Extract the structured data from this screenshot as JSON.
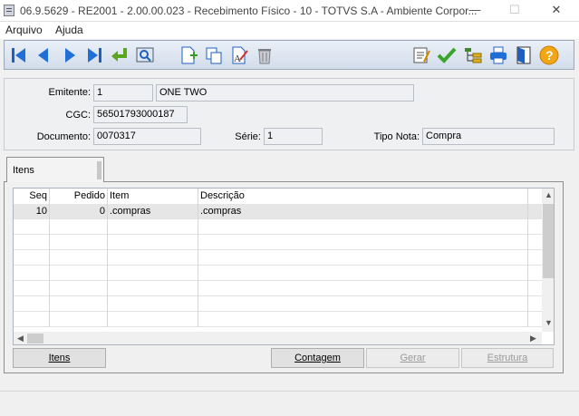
{
  "window": {
    "title": "06.9.5629 - RE2001 - 2.00.00.023 - Recebimento Físico - 10 - TOTVS S.A - Ambiente Corpor...",
    "minimize": "—",
    "maximize": "☐",
    "close": "✕"
  },
  "menu": {
    "items": [
      "Arquivo",
      "Ajuda"
    ]
  },
  "toolbar": {
    "nav_icons": [
      "first-record-icon",
      "previous-record-icon",
      "next-record-icon",
      "last-record-icon",
      "go-to-icon",
      "search-icon"
    ],
    "edit_icons": [
      "new-record-icon",
      "copy-record-icon",
      "edit-record-icon",
      "delete-record-icon"
    ],
    "right_icons": [
      "report-icon",
      "confirm-check-icon",
      "hierarchy-icon",
      "print-icon",
      "exit-door-icon",
      "help-icon"
    ]
  },
  "form": {
    "emitente_label": "Emitente:",
    "emitente_code": "1",
    "emitente_name": "ONE TWO",
    "cgc_label": "CGC:",
    "cgc_value": "56501793000187",
    "documento_label": "Documento:",
    "documento_value": "0070317",
    "serie_label": "Série:",
    "serie_value": "1",
    "tipo_nota_label": "Tipo Nota:",
    "tipo_nota_value": "Compra"
  },
  "tab": {
    "label": "Itens"
  },
  "grid": {
    "columns": [
      "Seq",
      "Pedido",
      "Item",
      "Descrição"
    ],
    "rows": [
      {
        "seq": "10",
        "pedido": "0",
        "item": ".compras",
        "descricao": ".compras"
      }
    ],
    "scroll_up": "▲",
    "scroll_down": "▼",
    "scroll_left": "◀",
    "scroll_right": "▶"
  },
  "buttons": {
    "itens": "Itens",
    "contagem": "Contagem",
    "gerar": "Gerar",
    "estrutura": "Estrutura"
  }
}
